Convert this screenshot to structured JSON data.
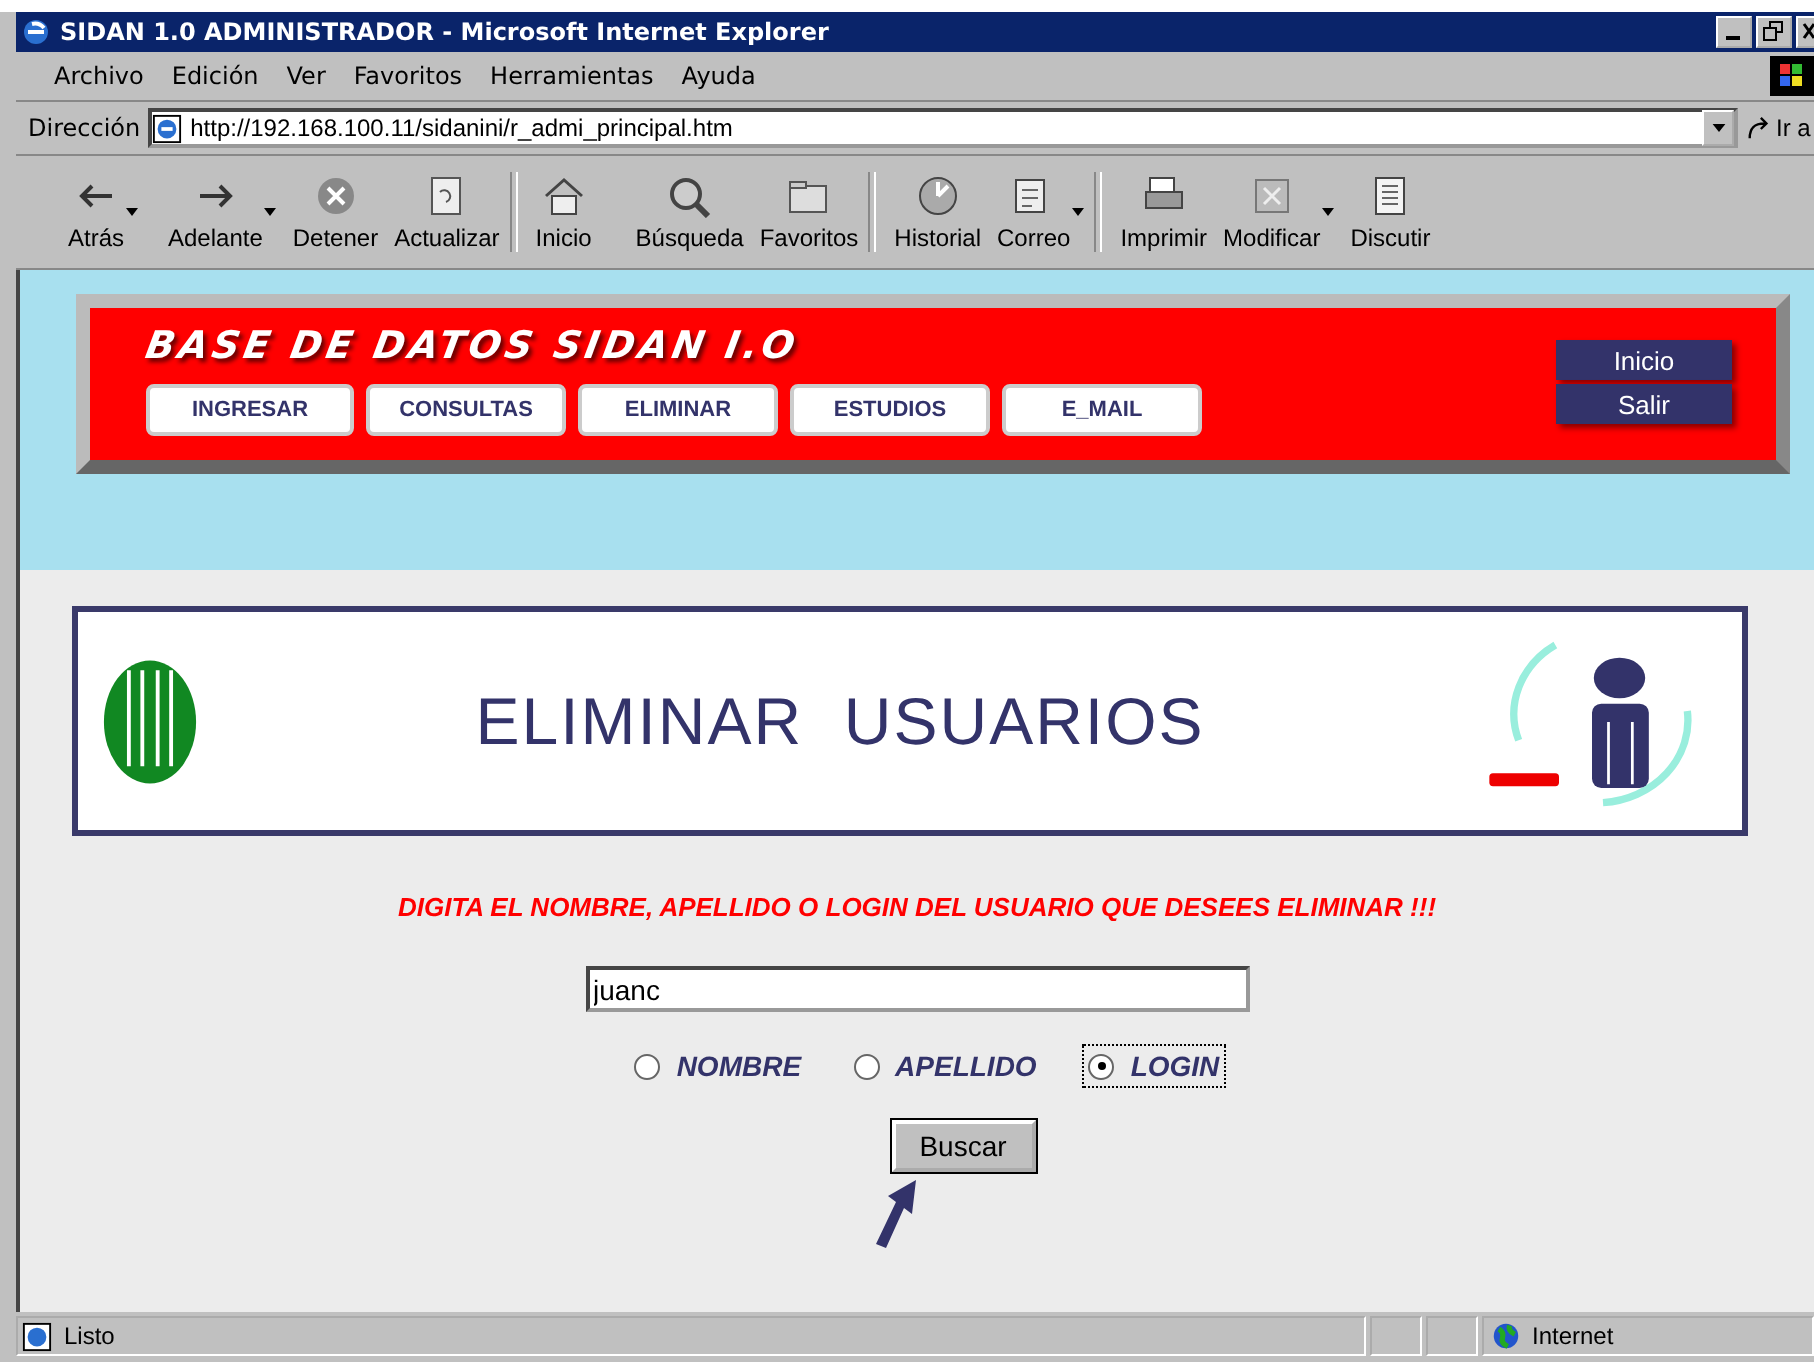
{
  "window": {
    "title": "SIDAN 1.0 ADMINISTRADOR - Microsoft Internet Explorer"
  },
  "menu": [
    "Archivo",
    "Edición",
    "Ver",
    "Favoritos",
    "Herramientas",
    "Ayuda"
  ],
  "address": {
    "label": "Dirección",
    "url": "http://192.168.100.11/sidanini/r_admi_principal.htm",
    "go": "Ir a"
  },
  "toolbar": [
    {
      "label": "Atrás",
      "has_menu": true
    },
    {
      "label": "Adelante",
      "has_menu": true
    },
    {
      "label": "Detener",
      "has_menu": false
    },
    {
      "label": "Actualizar",
      "has_menu": false
    },
    {
      "label": "Inicio",
      "has_menu": false
    },
    {
      "label": "Búsqueda",
      "has_menu": false
    },
    {
      "label": "Favoritos",
      "has_menu": false
    },
    {
      "label": "Historial",
      "has_menu": false
    },
    {
      "label": "Correo",
      "has_menu": true
    },
    {
      "label": "Imprimir",
      "has_menu": false
    },
    {
      "label": "Modificar",
      "has_menu": true
    },
    {
      "label": "Discutir",
      "has_menu": false
    }
  ],
  "banner": {
    "title": "BASE DE DATOS SIDAN I.O",
    "nav": [
      "INGRESAR",
      "CONSULTAS",
      "ELIMINAR",
      "ESTUDIOS",
      "E_MAIL"
    ],
    "side": [
      "Inicio",
      "Salir"
    ]
  },
  "header": {
    "title": "ELIMINAR  USUARIOS"
  },
  "form": {
    "instruction": "DIGITA EL NOMBRE, APELLIDO O LOGIN DEL USUARIO QUE DESEES ELIMINAR !!!",
    "search_value": "juanc",
    "options": [
      {
        "label": "NOMBRE",
        "selected": false
      },
      {
        "label": "APELLIDO",
        "selected": false
      },
      {
        "label": "LOGIN",
        "selected": true
      }
    ],
    "button": "Buscar"
  },
  "status_bar": {
    "text": "Listo",
    "zone": "Internet"
  }
}
